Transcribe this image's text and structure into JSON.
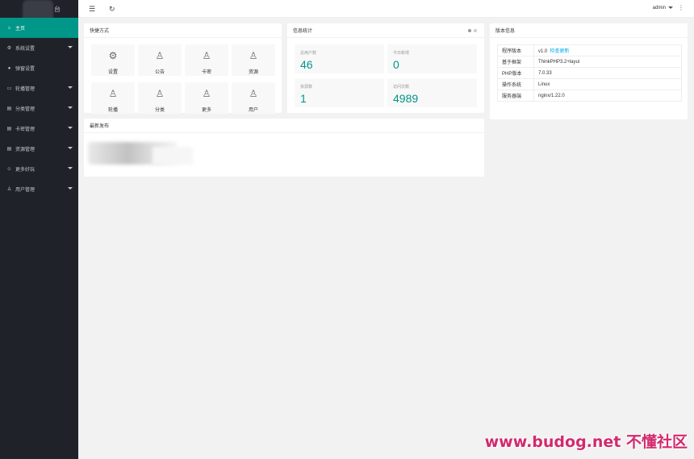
{
  "logo": {
    "text": "台"
  },
  "sidebar": {
    "items": [
      {
        "label": "主页",
        "icon": "⌂",
        "icon_name": "home-icon",
        "active": true,
        "caret": false
      },
      {
        "label": "系统设置",
        "icon": "⚙",
        "icon_name": "gear-icon",
        "active": false,
        "caret": true
      },
      {
        "label": "弹窗设置",
        "icon": "●",
        "icon_name": "dot-icon",
        "active": false,
        "caret": false
      },
      {
        "label": "轮播管理",
        "icon": "▭",
        "icon_name": "carousel-icon",
        "active": false,
        "caret": true
      },
      {
        "label": "分类管理",
        "icon": "▤",
        "icon_name": "category-icon",
        "active": false,
        "caret": true
      },
      {
        "label": "卡密管理",
        "icon": "▤",
        "icon_name": "card-icon",
        "active": false,
        "caret": true
      },
      {
        "label": "资源管理",
        "icon": "▤",
        "icon_name": "resource-icon",
        "active": false,
        "caret": true
      },
      {
        "label": "更多好玩",
        "icon": "☺",
        "icon_name": "smile-icon",
        "active": false,
        "caret": true
      },
      {
        "label": "用户管理",
        "icon": "♙",
        "icon_name": "user-icon",
        "active": false,
        "caret": true
      }
    ]
  },
  "header": {
    "menu_icon": "☰",
    "refresh_icon": "↻",
    "user": "admin",
    "more_icon": "⋮"
  },
  "quick": {
    "title": "快捷方式",
    "items": [
      {
        "label": "设置",
        "icon": "⚙",
        "icon_name": "gear-icon"
      },
      {
        "label": "公告",
        "icon": "♙",
        "icon_name": "person-icon"
      },
      {
        "label": "卡密",
        "icon": "♙",
        "icon_name": "person-icon"
      },
      {
        "label": "资源",
        "icon": "♙",
        "icon_name": "person-icon"
      },
      {
        "label": "轮播",
        "icon": "♙",
        "icon_name": "person-icon"
      },
      {
        "label": "分类",
        "icon": "♙",
        "icon_name": "person-icon"
      },
      {
        "label": "更多",
        "icon": "♙",
        "icon_name": "person-icon"
      },
      {
        "label": "用户",
        "icon": "♙",
        "icon_name": "person-icon"
      }
    ]
  },
  "stats": {
    "title": "信息统计",
    "items": [
      {
        "label": "总用户数",
        "value": "46"
      },
      {
        "label": "今日新增",
        "value": "0"
      },
      {
        "label": "资源数",
        "value": "1"
      },
      {
        "label": "访问次数",
        "value": "4989"
      }
    ]
  },
  "version": {
    "title": "版本信息",
    "rows": [
      {
        "key": "程序版本",
        "value": "v1.0",
        "link": "检查更新"
      },
      {
        "key": "基于框架",
        "value": "ThinkPHP3.2+layui",
        "link": ""
      },
      {
        "key": "PHP版本",
        "value": "7.0.33",
        "link": ""
      },
      {
        "key": "操作系统",
        "value": "Linux",
        "link": ""
      },
      {
        "key": "服务器端",
        "value": "nginx/1.22.0",
        "link": ""
      }
    ]
  },
  "latest": {
    "title": "最新发布"
  },
  "watermark": "www.budog.net 不懂社区",
  "colors": {
    "accent": "#009688",
    "sidebar": "#20222a",
    "link": "#01aaed",
    "watermark": "#d12a6e"
  }
}
